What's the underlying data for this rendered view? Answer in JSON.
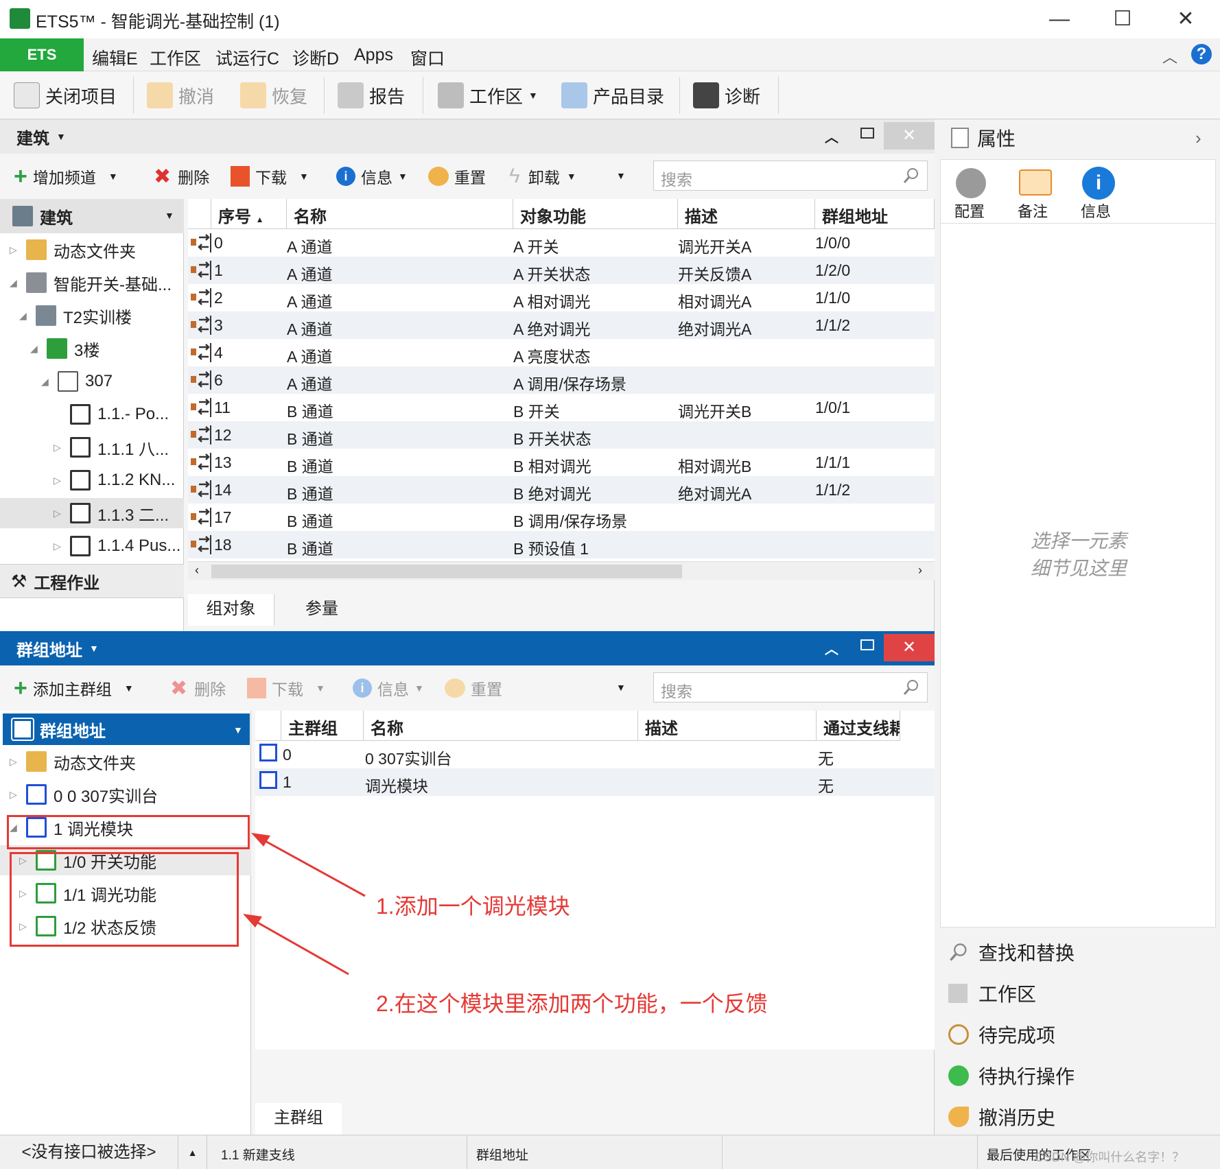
{
  "window": {
    "title": "ETS5™ - 智能调光-基础控制 (1)",
    "minimize": "—",
    "maximize": "☐",
    "close": "✕"
  },
  "menubar": {
    "ets": "ETS",
    "items": [
      "编辑E",
      "工作区",
      "试运行C",
      "诊断D",
      "Apps",
      "窗口"
    ]
  },
  "toolbar": {
    "close_project": "关闭项目",
    "undo": "撤消",
    "redo": "恢复",
    "report": "报告",
    "workspace": "工作区",
    "catalog": "产品目录",
    "diagnose": "诊断"
  },
  "building": {
    "title": "建筑",
    "toolbar": {
      "add_channel": "增加频道",
      "delete": "删除",
      "download": "下载",
      "info": "信息",
      "reset": "重置",
      "unload": "卸载",
      "search_placeholder": "搜索"
    },
    "tree_header": "建筑",
    "tree": [
      {
        "label": "动态文件夹"
      },
      {
        "label": "智能开关-基础..."
      },
      {
        "label": "T2实训楼"
      },
      {
        "label": "3楼"
      },
      {
        "label": "307"
      },
      {
        "label": "1.1.- Po..."
      },
      {
        "label": "1.1.1 八..."
      },
      {
        "label": "1.1.2 KN..."
      },
      {
        "label": "1.1.3 二..."
      },
      {
        "label": "1.1.4 Pus..."
      }
    ],
    "tree_footer": "工程作业",
    "columns": [
      "序号",
      "名称",
      "对象功能",
      "描述",
      "群组地址"
    ],
    "rows": [
      [
        "0",
        "A 通道",
        "A 开关",
        "调光开关A",
        "1/0/0"
      ],
      [
        "1",
        "A 通道",
        "A 开关状态",
        "开关反馈A",
        "1/2/0"
      ],
      [
        "2",
        "A 通道",
        "A 相对调光",
        "相对调光A",
        "1/1/0"
      ],
      [
        "3",
        "A 通道",
        "A 绝对调光",
        "绝对调光A",
        "1/1/2"
      ],
      [
        "4",
        "A 通道",
        "A 亮度状态",
        "",
        ""
      ],
      [
        "6",
        "A 通道",
        "A 调用/保存场景",
        "",
        ""
      ],
      [
        "11",
        "B 通道",
        "B 开关",
        "调光开关B",
        "1/0/1"
      ],
      [
        "12",
        "B 通道",
        "B 开关状态",
        "",
        ""
      ],
      [
        "13",
        "B 通道",
        "B 相对调光",
        "相对调光B",
        "1/1/1"
      ],
      [
        "14",
        "B 通道",
        "B 绝对调光",
        "绝对调光A",
        "1/1/2"
      ],
      [
        "17",
        "B 通道",
        "B 调用/保存场景",
        "",
        ""
      ],
      [
        "18",
        "B 通道",
        "B 预设值 1",
        "",
        ""
      ]
    ],
    "tabs": [
      "组对象",
      "参量"
    ]
  },
  "groups": {
    "title": "群组地址",
    "toolbar": {
      "add_main": "添加主群组",
      "delete": "删除",
      "download": "下载",
      "info": "信息",
      "reset": "重置",
      "search_placeholder": "搜索"
    },
    "tree_header": "群组地址",
    "tree": [
      {
        "label": "动态文件夹"
      },
      {
        "label": "0 0 307实训台"
      },
      {
        "label": "1 调光模块"
      },
      {
        "label": "1/0 开关功能"
      },
      {
        "label": "1/1 调光功能"
      },
      {
        "label": "1/2 状态反馈"
      }
    ],
    "columns": [
      "主群组",
      "名称",
      "描述",
      "通过支线耦"
    ],
    "rows": [
      [
        "0",
        "0 307实训台",
        "",
        "无"
      ],
      [
        "1",
        "调光模块",
        "",
        "无"
      ]
    ],
    "tab": "主群组"
  },
  "properties": {
    "title": "属性",
    "tabs": [
      "配置",
      "备注",
      "信息"
    ],
    "placeholder_line1": "选择一元素",
    "placeholder_line2": "细节见这里",
    "links": [
      "查找和替换",
      "工作区",
      "待完成项",
      "待执行操作",
      "撤消历史"
    ]
  },
  "annotations": {
    "note1": "1.添加一个调光模块",
    "note2": "2.在这个模块里添加两个功能，一个反馈"
  },
  "statusbar": {
    "interface": "<没有接口被选择>",
    "line": "1.1 新建支线",
    "view": "群组地址",
    "last_workspace": "最后使用的工作区",
    "watermark": "CSDN @你叫什么名字！？"
  },
  "colors": {
    "ets_green": "#22a83c",
    "group_blue": "#0b63b0",
    "close_red": "#e04343",
    "annotation_red": "#e53935"
  }
}
